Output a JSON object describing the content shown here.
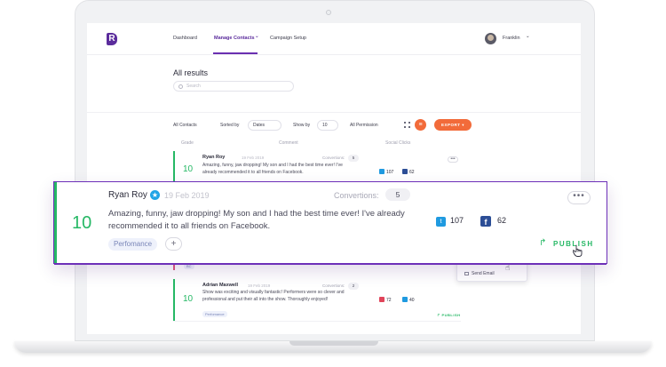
{
  "nav": {
    "links": [
      "Dashboard",
      "Manage Contacts",
      "Campaign Setup"
    ],
    "active_chevron": "⌄",
    "user": "Franklin",
    "user_chevron": "⌄"
  },
  "page": {
    "title": "All results",
    "search_placeholder": "Search"
  },
  "filters": {
    "contacts": "All Contacts",
    "sorted_by_label": "Sorted by",
    "sorted_by_value": "Dates",
    "show_by_label": "Show by",
    "show_by_value": "10",
    "permission": "All Permission",
    "export_label": "EXPORT"
  },
  "columns": [
    "Grade",
    "Comment",
    "Social Clicks"
  ],
  "rows": [
    {
      "grade": "10",
      "name": "Ryan Roy",
      "date": "19 Feb 2019",
      "conversions_label": "Convertions:",
      "conversions": "5",
      "comment": "Amazing, funny, jaw dropping! My son and I had the best time ever! I've already recommended it to all friends on Facebook.",
      "twitter": "107",
      "facebook": "62"
    },
    {
      "grade": "10",
      "name": "Adrian Maxwell",
      "date": "19 Feb 2019",
      "conversions_label": "Convertions:",
      "conversions": "2",
      "comment": "Show was exciting and visually fantastic! Performers were so clever and professional and put their all into the show. Thoroughly enjoyed!",
      "tag": "Perfomance",
      "publish": "PUBLISH",
      "stat_a": "72",
      "stat_b": "40"
    }
  ],
  "partial_tag": "BC",
  "dropdown": {
    "item": "Send Email"
  },
  "card": {
    "grade": "10",
    "name": "Ryan Roy",
    "date": "19 Feb 2019",
    "conversions_label": "Convertions:",
    "conversions": "5",
    "comment": "Amazing, funny, jaw dropping! My son and I had the best time ever! I've already recommended it to all friends on Facebook.",
    "twitter": "107",
    "facebook": "62",
    "tag": "Perfomance",
    "add_label": "+",
    "more_label": "•••",
    "publish_label": "PUBLISH"
  },
  "colors": {
    "brand": "#5b2c9c",
    "accent_orange": "#f26b3a",
    "grade_green": "#26b865",
    "twitter": "#1f9ae0",
    "facebook": "#2c4e96"
  }
}
